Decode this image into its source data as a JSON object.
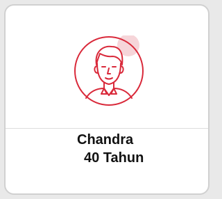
{
  "profile": {
    "name": "Chandra",
    "age": "40 Tahun",
    "avatar_icon": "man-portrait-icon",
    "accent_color": "#d9293a"
  }
}
